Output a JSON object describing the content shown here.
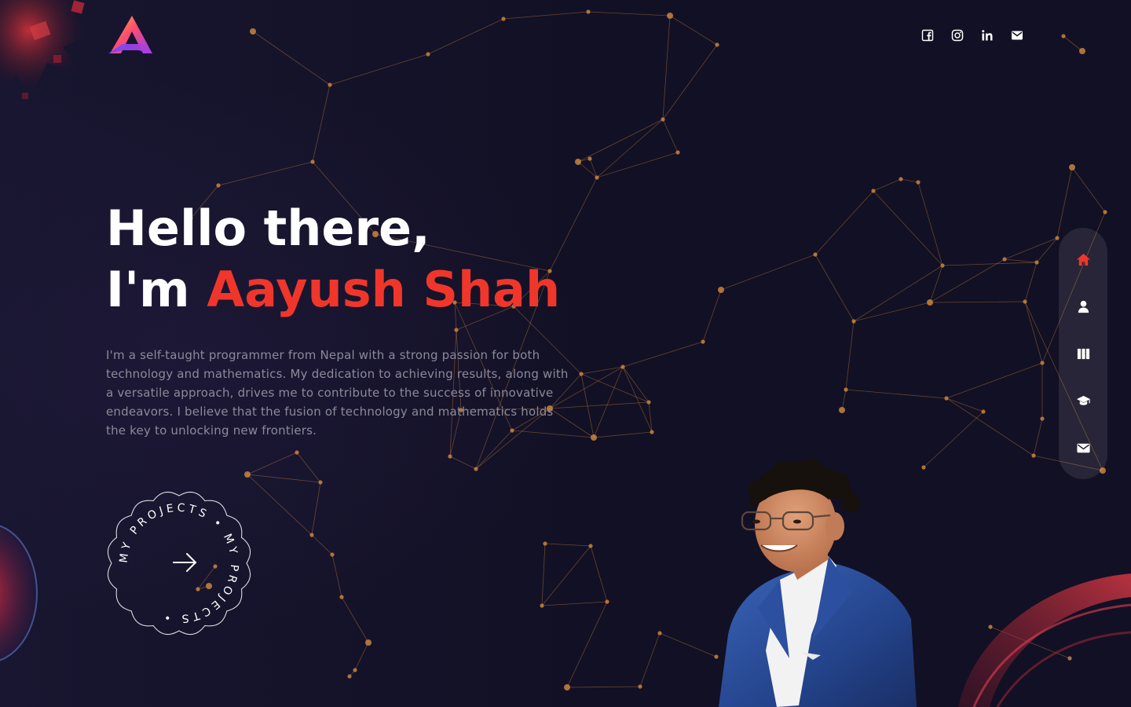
{
  "brand": {
    "logo_icon": "letter-a-logo"
  },
  "header": {
    "social_links": [
      {
        "name": "facebook",
        "icon": "facebook-icon"
      },
      {
        "name": "instagram",
        "icon": "instagram-icon"
      },
      {
        "name": "linkedin",
        "icon": "linkedin-icon"
      },
      {
        "name": "email",
        "icon": "mail-icon"
      }
    ]
  },
  "hero": {
    "greeting": "Hello there,",
    "intro_prefix": "I'm ",
    "name": "Aayush Shah",
    "description": "I'm a self-taught programmer from Nepal with a strong passion for both technology and mathematics. My dedication to achieving results, along with a versatile approach, drives me to contribute to the success of innovative endeavors. I believe that the fusion of technology and mathematics holds the key to unlocking new frontiers.",
    "projects_button": {
      "ring_text": "MY PROJECTS • MY PROJECTS •",
      "icon": "arrow-right-icon"
    }
  },
  "side_nav": [
    {
      "id": "home",
      "icon": "home-icon",
      "active": true
    },
    {
      "id": "about",
      "icon": "user-icon",
      "active": false
    },
    {
      "id": "portfolio",
      "icon": "columns-icon",
      "active": false
    },
    {
      "id": "education",
      "icon": "graduation-cap-icon",
      "active": false
    },
    {
      "id": "contact",
      "icon": "mail-icon",
      "active": false
    }
  ],
  "colors": {
    "background": "#131226",
    "accent": "#f0362b",
    "network": "#c9843e",
    "text_muted": "#8b8a99",
    "nav_bg": "rgba(255,255,255,0.09)"
  }
}
